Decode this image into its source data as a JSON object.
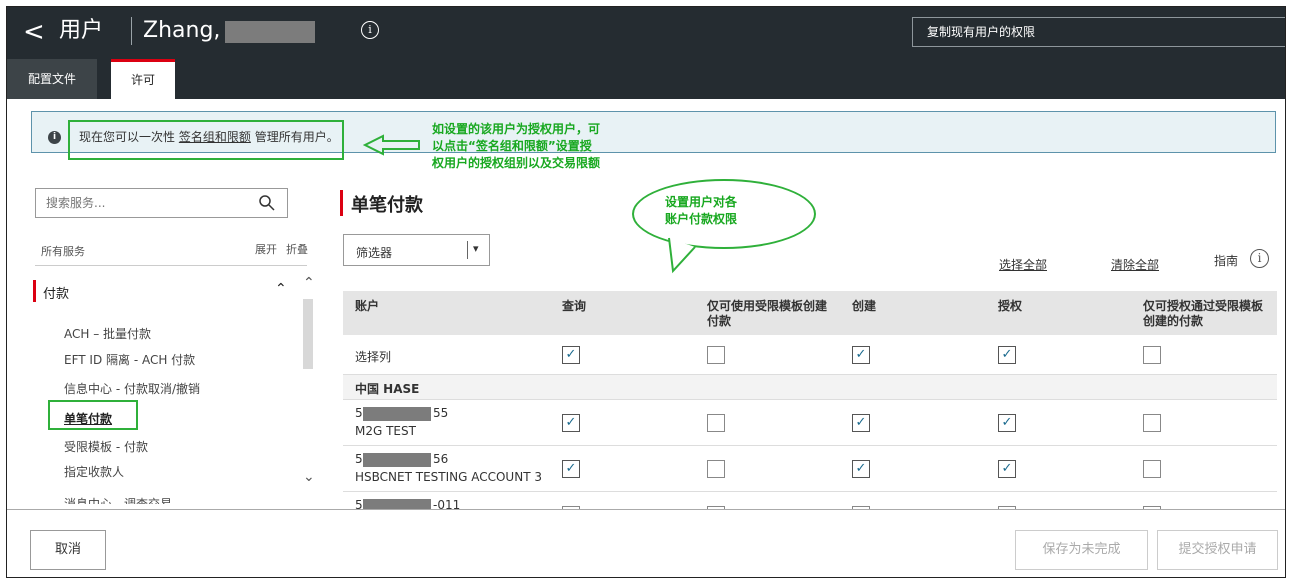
{
  "header": {
    "back_glyph": "<",
    "title": "用户",
    "username": "Zhang,",
    "copy_placeholder": "复制现有用户的权限"
  },
  "tabs": [
    {
      "label": "配置文件",
      "active": false
    },
    {
      "label": "许可",
      "active": true
    }
  ],
  "banner": {
    "text_before": "现在您可以一次性",
    "link": "签名组和限额",
    "text_after": "管理所有用户。",
    "annotation_lines": [
      "如设置的该用户为授权用户，可",
      "以点击“签名组和限额”设置授",
      "权用户的授权组别以及交易限额"
    ]
  },
  "sidebar": {
    "search_placeholder": "搜索服务...",
    "all_services": "所有服务",
    "expand": "展开",
    "collapse": "折叠",
    "category": "付款",
    "items": [
      "ACH – 批量付款",
      "EFT ID 隔离 - ACH 付款",
      "信息中心 - 付款取消/撤销",
      "单笔付款",
      "受限模板 - 付款",
      "指定收款人",
      "消息中心 - 调查交易"
    ],
    "active_item": "单笔付款"
  },
  "main": {
    "title": "单笔付款",
    "bubble_lines": [
      "设置用户对各",
      "账户付款权限"
    ],
    "filter_label": "筛选器",
    "select_all": "选择全部",
    "clear_all": "清除全部",
    "guide": "指南"
  },
  "table": {
    "columns": [
      "账户",
      "查询",
      "仅可使用受限模板创建付款",
      "创建",
      "授权",
      "仅可授权通过受限模板创建的付款"
    ],
    "column_lines": [
      [
        "账户"
      ],
      [
        "查询"
      ],
      [
        "仅可使用受限模板创建",
        "付款"
      ],
      [
        "创建"
      ],
      [
        "授权"
      ],
      [
        "仅可授权通过受限模板",
        "创建的付款"
      ]
    ],
    "select_row_label": "选择列",
    "select_row": [
      true,
      false,
      true,
      true,
      false
    ],
    "group_label": "中国 HASE",
    "rows": [
      {
        "account_prefix": "5",
        "account_suffix": "55",
        "name": "M2G TEST",
        "checks": [
          true,
          false,
          true,
          true,
          false
        ]
      },
      {
        "account_prefix": "5",
        "account_suffix": "56",
        "name": "HSBCNET TESTING ACCOUNT 3",
        "checks": [
          true,
          false,
          true,
          true,
          false
        ]
      },
      {
        "account_prefix": "5",
        "account_suffix": "-011",
        "name": "",
        "checks": [
          false,
          false,
          false,
          false,
          false
        ]
      }
    ]
  },
  "footer": {
    "cancel": "取消",
    "save_draft": "保存为未完成",
    "submit": "提交授权申请"
  },
  "colors": {
    "header_bg": "#252c31",
    "accent_red": "#db0011",
    "annotation_green": "#2fb03a",
    "banner_bg": "#e8f2f5"
  }
}
